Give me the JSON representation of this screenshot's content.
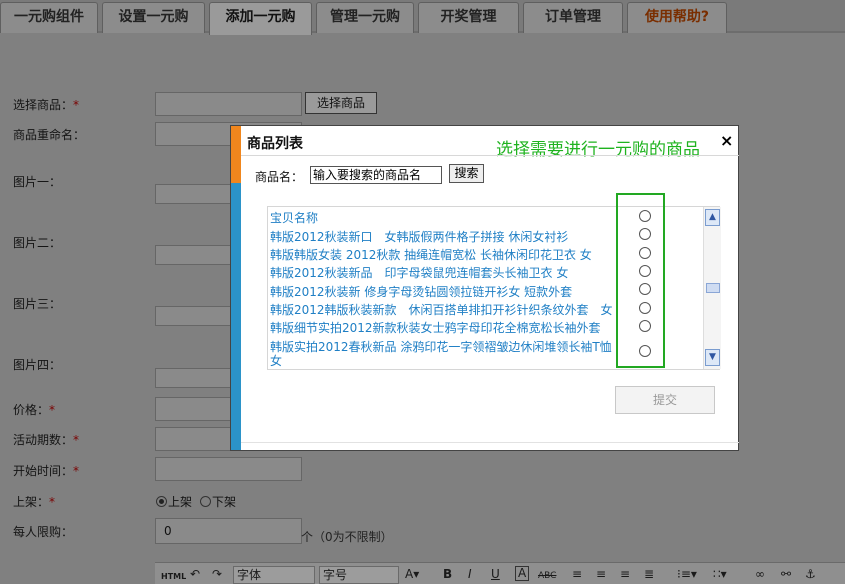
{
  "tabs": [
    {
      "label": "一元购组件",
      "active": false
    },
    {
      "label": "设置一元购",
      "active": false
    },
    {
      "label": "添加一元购",
      "active": true
    },
    {
      "label": "管理一元购",
      "active": false
    },
    {
      "label": "开奖管理",
      "active": false
    },
    {
      "label": "订单管理",
      "active": false
    },
    {
      "label": "使用帮助?",
      "active": false
    }
  ],
  "form": {
    "select_goods_label": "选择商品：",
    "select_goods_button": "选择商品",
    "rename_label": "商品重命名：",
    "image1_label": "图片一：",
    "image2_label": "图片二：",
    "image3_label": "图片三：",
    "image4_label": "图片四：",
    "price_label": "价格：",
    "period_label": "活动期数：",
    "start_label": "开始时间：",
    "listing_label": "上架：",
    "listing_on": "上架",
    "listing_off": "下架",
    "listing_value": "上架",
    "limit_label": "每人限购：",
    "limit_value": "0",
    "limit_note": "个（0为不限制）",
    "required_mark": "*"
  },
  "editor_toolbar": {
    "html": "HTML",
    "font": "字体",
    "size": "字号",
    "a_label": "A",
    "bold": "B",
    "italic": "I",
    "underline": "U",
    "font_color": "A",
    "strike": "ABC"
  },
  "modal": {
    "title": "商品列表",
    "hint": "选择需要进行一元购的商品",
    "close": "×",
    "search_label": "商品名：",
    "search_value": "输入要搜索的商品名",
    "search_button": "搜索",
    "column_header": "宝贝名称",
    "items": [
      "韩版2012秋装新口　女韩版假两件格子拼接 休闲女衬衫",
      "韩版韩版女装  2012秋款 抽绳连帽宽松 长袖休闲印花卫衣 女",
      "韩版2012秋装新品　印字母袋鼠兜连帽套头长袖卫衣 女",
      "韩版2012秋装新 修身字母烫钻圆领拉链开衫女 短款外套",
      "韩版2012韩版秋装新款　休闲百搭单排扣开衫针织条纹外套　女",
      "韩版细节实拍2012新款秋装女士鸦字母印花全棉宽松长袖外套",
      "韩版实拍2012春秋新品 涂鸦印花一字领褶皱边休闲堆领长袖T恤",
      "女"
    ],
    "submit": "提交"
  },
  "colors": {
    "overlay": "#808080",
    "accent_orange": "#f0861d",
    "accent_blue": "#2b93c9",
    "hint_green": "#1fb31f",
    "link_blue": "#1f7fc5"
  }
}
